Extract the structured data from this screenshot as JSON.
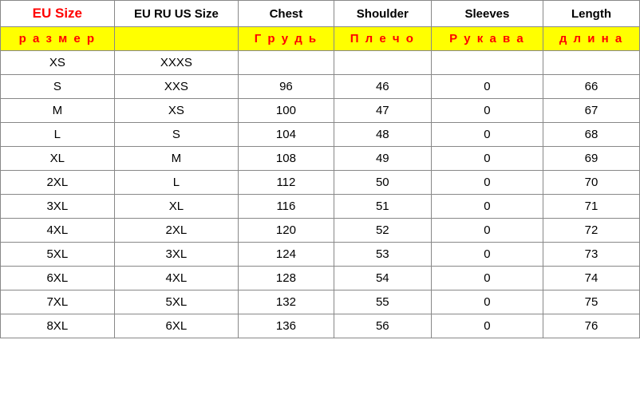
{
  "table": {
    "header1": {
      "col1": "EU Size",
      "col2": "EU RU US Size",
      "col3": "Chest",
      "col4": "Shoulder",
      "col5": "Sleeves",
      "col6": "Length"
    },
    "header2": {
      "col1": "р а з м е р",
      "col2": "",
      "col3": "Г р у д ь",
      "col4": "П л е ч о",
      "col5": "Р у к а в а",
      "col6": "д л и н а"
    },
    "rows": [
      {
        "eu": "XS",
        "ru": "XXXS",
        "chest": "",
        "shoulder": "",
        "sleeves": "",
        "length": ""
      },
      {
        "eu": "S",
        "ru": "XXS",
        "chest": "96",
        "shoulder": "46",
        "sleeves": "0",
        "length": "66"
      },
      {
        "eu": "M",
        "ru": "XS",
        "chest": "100",
        "shoulder": "47",
        "sleeves": "0",
        "length": "67"
      },
      {
        "eu": "L",
        "ru": "S",
        "chest": "104",
        "shoulder": "48",
        "sleeves": "0",
        "length": "68"
      },
      {
        "eu": "XL",
        "ru": "M",
        "chest": "108",
        "shoulder": "49",
        "sleeves": "0",
        "length": "69"
      },
      {
        "eu": "2XL",
        "ru": "L",
        "chest": "112",
        "shoulder": "50",
        "sleeves": "0",
        "length": "70"
      },
      {
        "eu": "3XL",
        "ru": "XL",
        "chest": "116",
        "shoulder": "51",
        "sleeves": "0",
        "length": "71"
      },
      {
        "eu": "4XL",
        "ru": "2XL",
        "chest": "120",
        "shoulder": "52",
        "sleeves": "0",
        "length": "72"
      },
      {
        "eu": "5XL",
        "ru": "3XL",
        "chest": "124",
        "shoulder": "53",
        "sleeves": "0",
        "length": "73"
      },
      {
        "eu": "6XL",
        "ru": "4XL",
        "chest": "128",
        "shoulder": "54",
        "sleeves": "0",
        "length": "74"
      },
      {
        "eu": "7XL",
        "ru": "5XL",
        "chest": "132",
        "shoulder": "55",
        "sleeves": "0",
        "length": "75"
      },
      {
        "eu": "8XL",
        "ru": "6XL",
        "chest": "136",
        "shoulder": "56",
        "sleeves": "0",
        "length": "76"
      }
    ]
  }
}
